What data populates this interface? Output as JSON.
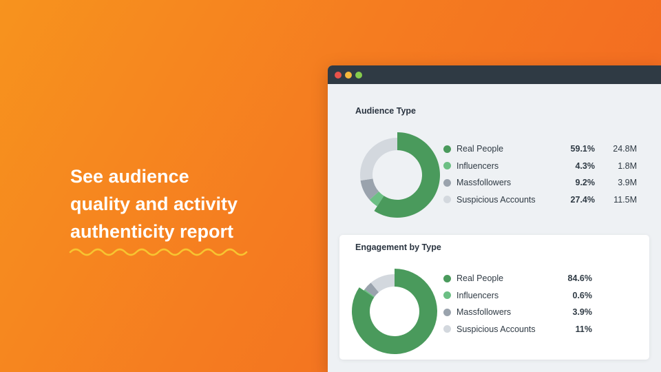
{
  "headline": {
    "lines": [
      "See audience",
      "quality and activity",
      "authenticity report"
    ]
  },
  "colors": {
    "real_people": "#4a9a5c",
    "influencers": "#6cbf84",
    "massfollowers": "#9aa3ad",
    "suspicious": "#d3d8de"
  },
  "audience_type": {
    "title": "Audience Type",
    "rows": [
      {
        "label": "Real People",
        "pct": "59.1%",
        "count": "24.8M",
        "value": 59.1
      },
      {
        "label": "Influencers",
        "pct": "4.3%",
        "count": "1.8M",
        "value": 4.3
      },
      {
        "label": "Massfollowers",
        "pct": "9.2%",
        "count": "3.9M",
        "value": 9.2
      },
      {
        "label": "Suspicious Accounts",
        "pct": "27.4%",
        "count": "11.5M",
        "value": 27.4
      }
    ]
  },
  "engagement_by_type": {
    "title": "Engagement by Type",
    "rows": [
      {
        "label": "Real People",
        "pct": "84.6%",
        "value": 84.6
      },
      {
        "label": "Influencers",
        "pct": "0.6%",
        "value": 0.6
      },
      {
        "label": "Massfollowers",
        "pct": "3.9%",
        "value": 3.9
      },
      {
        "label": "Suspicious Accounts",
        "pct": "11%",
        "value": 11
      }
    ]
  }
}
